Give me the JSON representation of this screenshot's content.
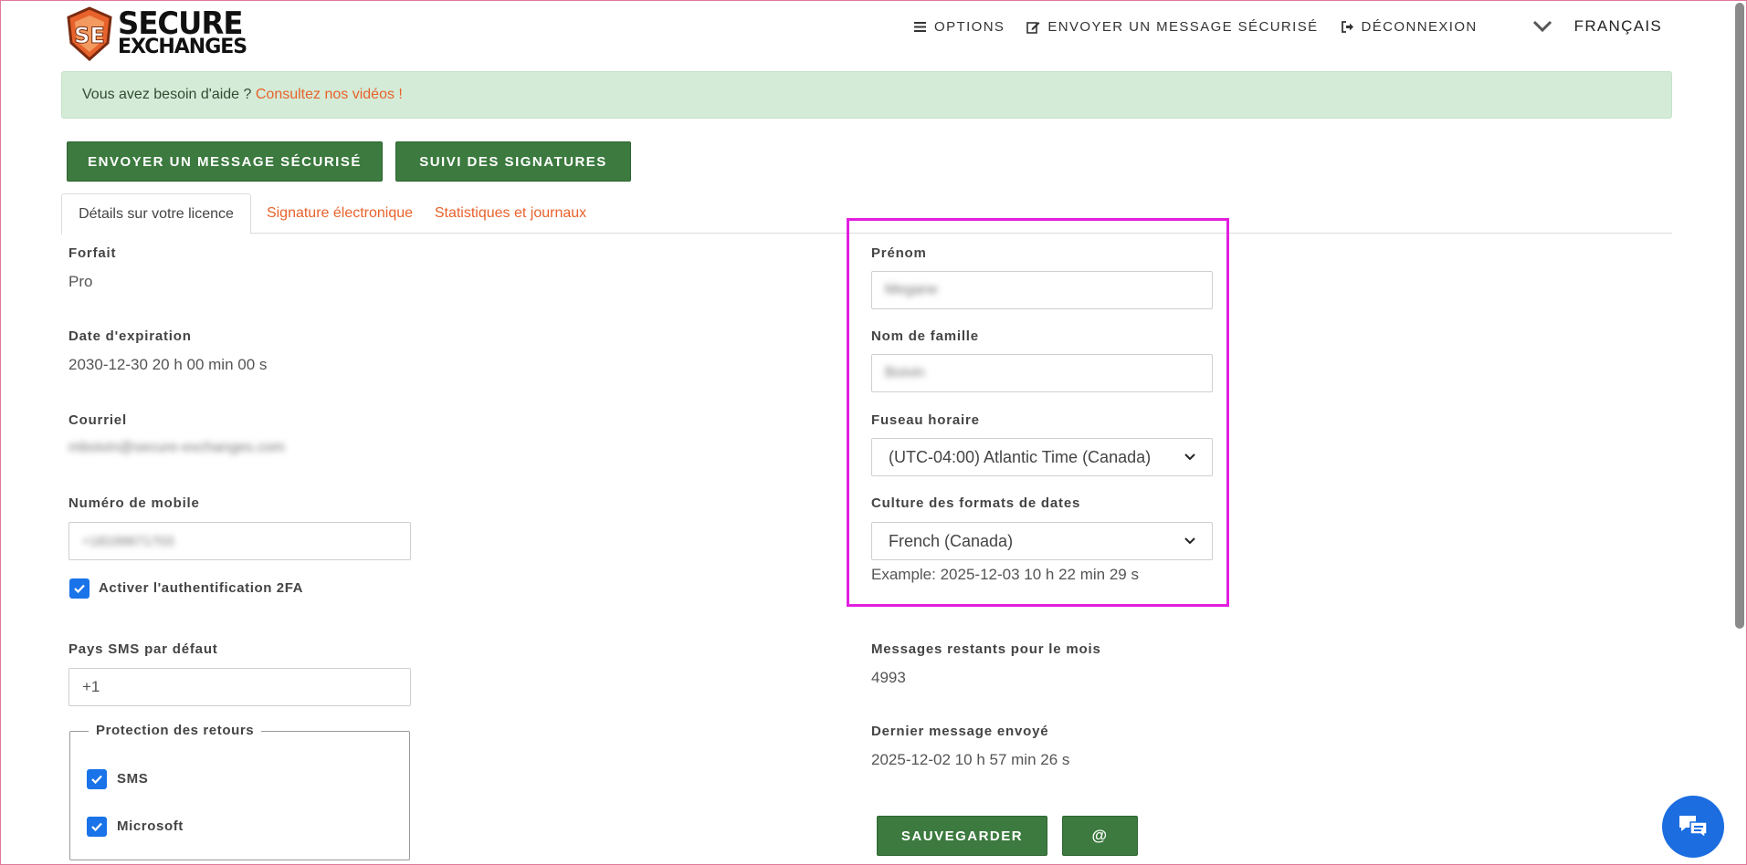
{
  "header": {
    "logo_line1": "SECURE",
    "logo_line2": "EXCHANGES",
    "nav": {
      "options": "OPTIONS",
      "send_secure": "ENVOYER UN MESSAGE SÉCURISÉ",
      "logout": "DÉCONNEXION"
    },
    "language": "FRANÇAIS"
  },
  "alert": {
    "text": "Vous avez besoin d'aide ?",
    "link": "Consultez nos vidéos !"
  },
  "actions": {
    "send_secure": "ENVOYER UN MESSAGE SÉCURISÉ",
    "signature_tracking": "SUIVI DES SIGNATURES"
  },
  "tabs": [
    {
      "label": "Détails sur votre licence",
      "active": true
    },
    {
      "label": "Signature électronique",
      "active": false
    },
    {
      "label": "Statistiques et journaux",
      "active": false
    }
  ],
  "left": {
    "plan_label": "Forfait",
    "plan_value": "Pro",
    "expiry_label": "Date d'expiration",
    "expiry_value": "2030-12-30 20 h 00 min 00 s",
    "email_label": "Courriel",
    "email_value": "mboivin@secure-exchanges.com",
    "mobile_label": "Numéro de mobile",
    "mobile_value": "+18199671703",
    "twofa_label": "Activer l'authentification 2FA",
    "sms_country_label": "Pays SMS par défaut",
    "sms_country_value": "+1",
    "return_protection": {
      "legend": "Protection des retours",
      "sms": "SMS",
      "microsoft": "Microsoft"
    }
  },
  "right": {
    "firstname_label": "Prénom",
    "firstname_value": "Megane",
    "lastname_label": "Nom de famille",
    "lastname_value": "Boivin",
    "timezone_label": "Fuseau horaire",
    "timezone_value": "(UTC-04:00) Atlantic Time (Canada)",
    "culture_label": "Culture des formats de dates",
    "culture_value": "French (Canada)",
    "example": "Example: 2025-12-03 10 h 22 min 29 s",
    "remaining_label": "Messages restants pour le mois",
    "remaining_value": "4993",
    "last_sent_label": "Dernier message envoyé",
    "last_sent_value": "2025-12-02 10 h 57 min 26 s",
    "save_button": "SAUVEGARDER",
    "at_button": "@"
  },
  "colors": {
    "green": "#3c7a3f",
    "link_orange": "#e8622c",
    "checkbox_blue": "#1a73e8",
    "highlight_magenta": "#e21ee0",
    "chat_blue": "#1b6de0"
  }
}
